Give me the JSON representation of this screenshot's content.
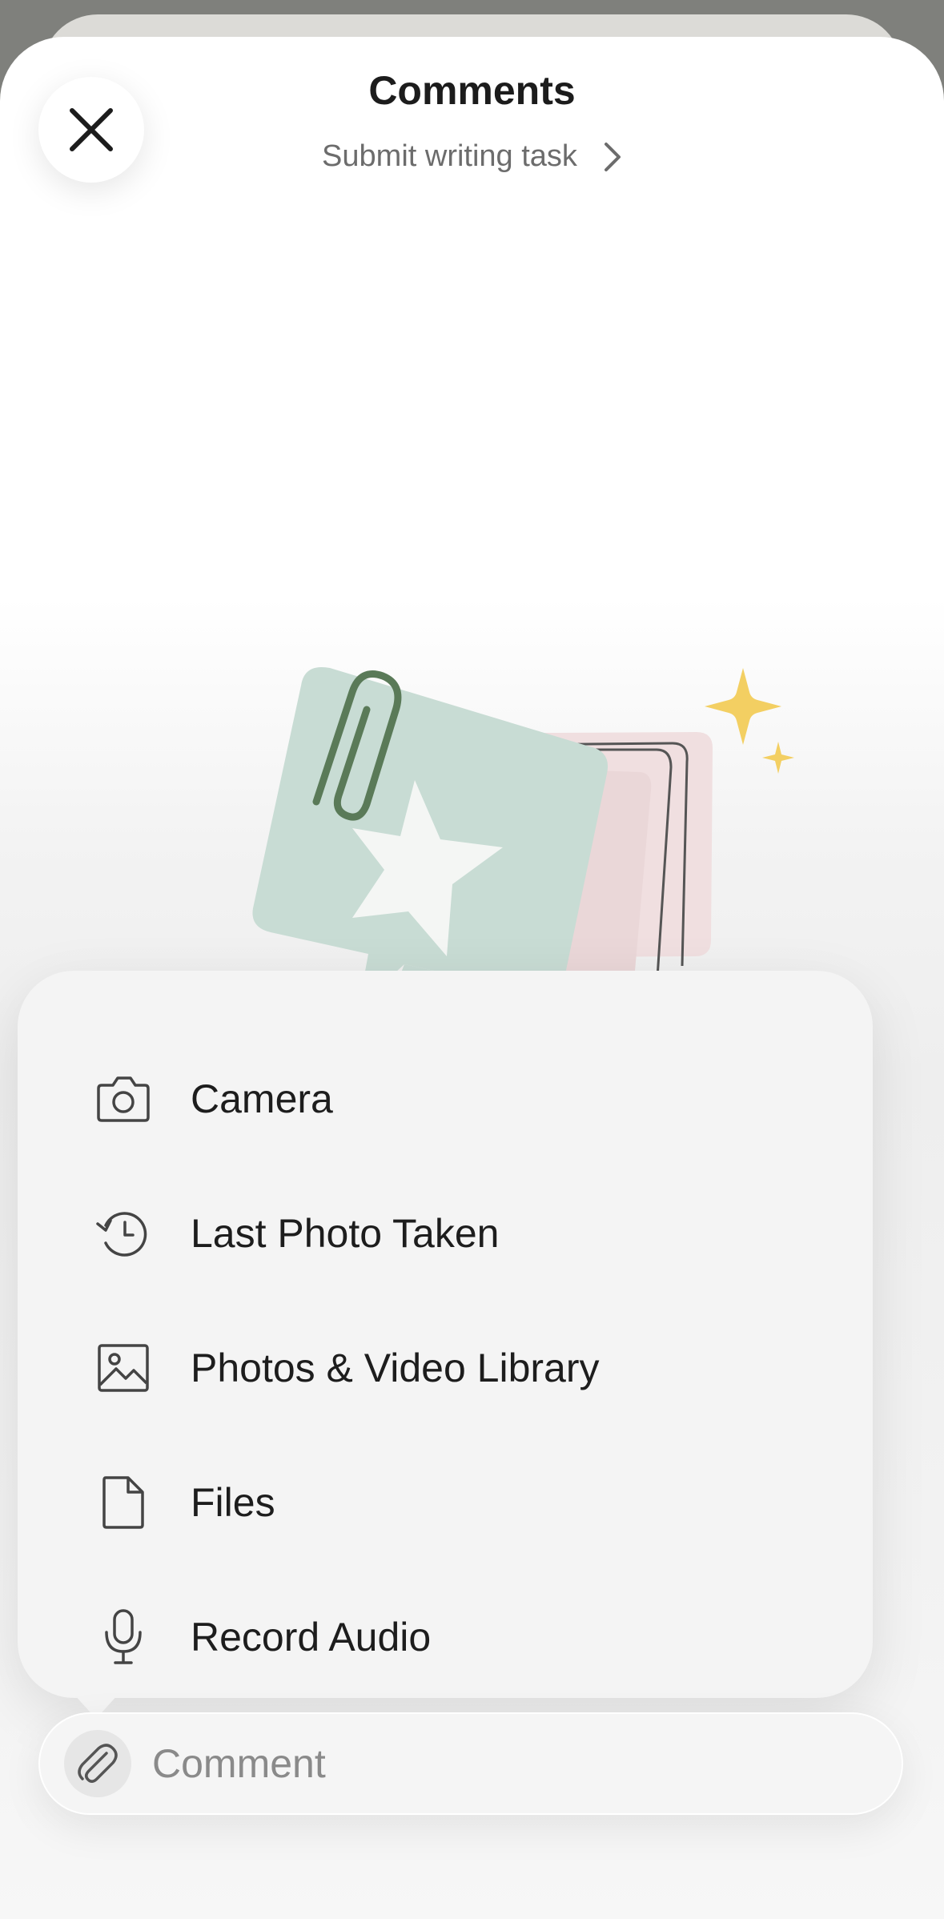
{
  "header": {
    "title": "Comments",
    "subtitle": "Submit writing task"
  },
  "attach_menu": {
    "items": [
      {
        "label": "Camera",
        "icon": "camera-icon"
      },
      {
        "label": "Last Photo Taken",
        "icon": "history-clock-icon"
      },
      {
        "label": "Photos & Video Library",
        "icon": "photo-icon"
      },
      {
        "label": "Files",
        "icon": "file-icon"
      },
      {
        "label": "Record Audio",
        "icon": "microphone-icon"
      }
    ]
  },
  "composer": {
    "placeholder": "Comment",
    "attach_icon": "paperclip-icon"
  },
  "colors": {
    "illustration_card": "#c8dcd4",
    "illustration_pink": "#f0dfe0",
    "sparkle": "#f3cf62"
  }
}
